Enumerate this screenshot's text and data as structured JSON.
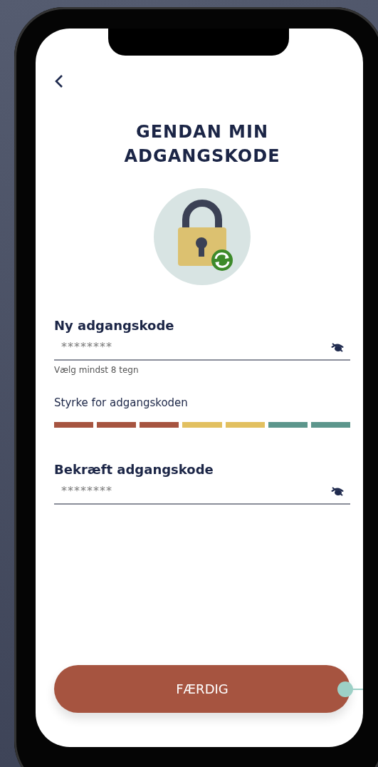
{
  "screen": {
    "title": "GENDAN MIN ADGANGSKODE"
  },
  "fields": [
    {
      "label": "Ny adgangskode",
      "value": "********",
      "hint": "Vælg mindst 8 tegn"
    },
    {
      "label": "Bekræft adgangskode",
      "value": "********"
    }
  ],
  "strength": {
    "label": "Styrke for adgangskoden",
    "segments": [
      {
        "color": "#a65440"
      },
      {
        "color": "#a65440"
      },
      {
        "color": "#a65440"
      },
      {
        "color": "#e2c060"
      },
      {
        "color": "#e2c060"
      },
      {
        "color": "#5c968c"
      },
      {
        "color": "#5c968c"
      }
    ]
  },
  "button": {
    "label": "FÆRDIG"
  }
}
